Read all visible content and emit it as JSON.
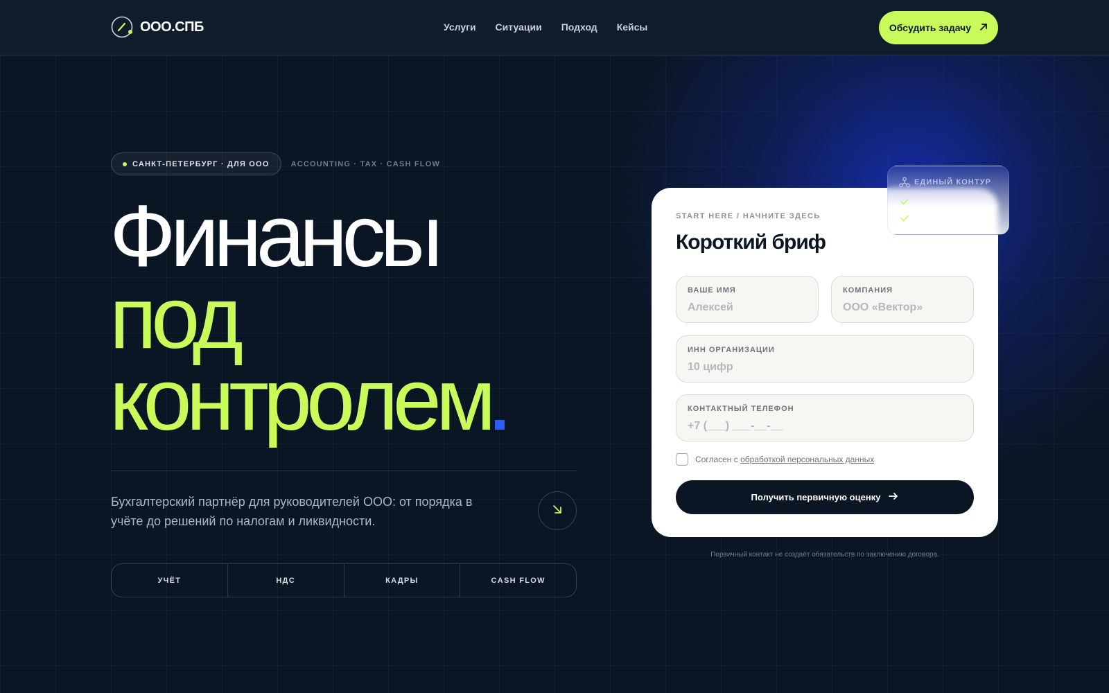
{
  "brand": {
    "name": "ООО.СПБ"
  },
  "nav": {
    "items": [
      "Услуги",
      "Ситуации",
      "Подход",
      "Кейсы"
    ],
    "cta_label": "Обсудить задачу"
  },
  "hero": {
    "pill": "САНКТ-ПЕТЕРБУРГ · ДЛЯ ООО",
    "tag_sub": "ACCOUNTING · TAX · CASH FLOW",
    "headline_line1": "Финансы",
    "headline_line2": "под",
    "headline_line3": "контролем",
    "lead": "Бухгалтерский партнёр для руководителей ООО: от порядка в учёте до решений по налогам и ликвидности.",
    "tabs": [
      "УЧЁТ",
      "НДС",
      "КАДРЫ",
      "CASH FLOW"
    ]
  },
  "brief": {
    "kicker": "START HERE / НАЧНИТЕ ЗДЕСЬ",
    "title": "Короткий бриф",
    "fields": {
      "name": {
        "label": "ВАШЕ ИМЯ",
        "placeholder": "Алексей"
      },
      "company": {
        "label": "КОМПАНИЯ",
        "placeholder": "ООО «Вектор»"
      },
      "inn": {
        "label": "ИНН ОРГАНИЗАЦИИ",
        "placeholder": "10 цифр"
      },
      "phone": {
        "label": "КОНТАКТНЫЙ ТЕЛЕФОН",
        "placeholder": "+7 (___) ___-__-__"
      }
    },
    "consent_text": "Согласен с ",
    "consent_link": "обработкой персональных данных",
    "submit_label": "Получить первичную оценку",
    "fineprint": "Первичный контакт не создаёт обязательств по заключению договора."
  },
  "badge": {
    "title": "ЕДИНЫЙ КОНТУР"
  },
  "colors": {
    "accent": "#c8fb5a",
    "background": "#0b1624",
    "blue_dot": "#2f5cff"
  },
  "icons": {
    "logo": "gauge-logo-icon",
    "cta": "arrow-up-right-icon",
    "round_button": "arrow-down-right-icon",
    "submit": "arrow-right-icon",
    "badge": "network-icon",
    "checks": "check-icon"
  }
}
